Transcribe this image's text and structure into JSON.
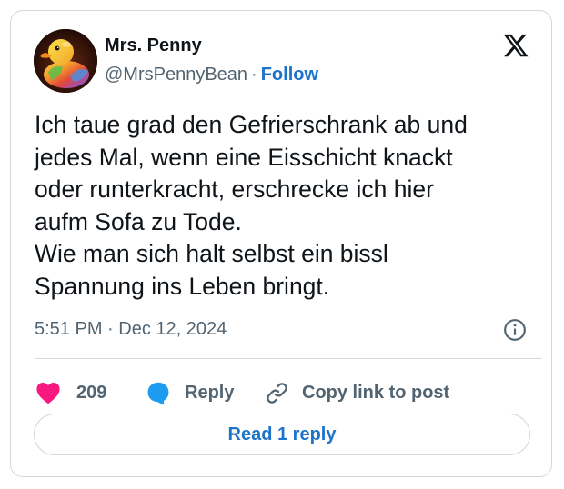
{
  "author": {
    "name": "Mrs. Penny",
    "handle": "@MrsPennyBean",
    "separator": "·",
    "follow_label": "Follow"
  },
  "tweet": {
    "lines": [
      "Ich taue grad den Gefrierschrank ab und",
      "jedes Mal, wenn eine Eisschicht knackt",
      "oder runterkracht, erschrecke ich hier",
      "aufm Sofa zu Tode.",
      "Wie man sich halt selbst ein bissl",
      "Spannung ins Leben bringt."
    ],
    "timestamp": "5:51 PM · Dec 12, 2024"
  },
  "actions": {
    "like_count": "209",
    "reply_label": "Reply",
    "copy_link_label": "Copy link to post"
  },
  "read_replies_label": "Read 1 reply",
  "icons": {
    "logo": "x-logo-icon",
    "info": "info-icon",
    "like": "heart-icon",
    "reply": "speech-bubble-icon",
    "copy": "link-icon"
  },
  "colors": {
    "accent": "#1d74c9",
    "heart": "#f91880",
    "reply_bubble": "#1d9bf0",
    "text": "#0f1419",
    "muted": "#536471",
    "border": "#cfd9de"
  }
}
